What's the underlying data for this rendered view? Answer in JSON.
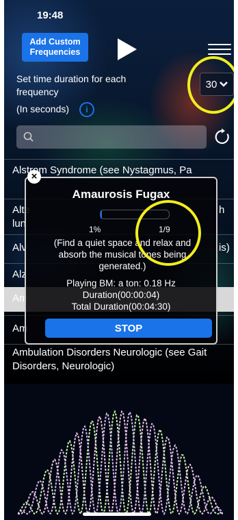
{
  "status": {
    "time": "19:48"
  },
  "header": {
    "add_button_label": "Add Custom Frequencies"
  },
  "duration": {
    "label": "Set time duration for each frequency",
    "units_label": "(In seconds)",
    "selected_value": "30"
  },
  "search": {
    "value": ""
  },
  "list": {
    "items": [
      {
        "label": "Alstrom Syndrome (see Nystagmus, Pa"
      },
      {
        "label": "Alte"
      },
      {
        "label": "lun"
      },
      {
        "label": "Alv"
      },
      {
        "label": "Alz"
      },
      {
        "label": "Am"
      },
      {
        "label": "Am"
      },
      {
        "label": "Ambulation Disorders Neurologic (see Gait Disorders, Neurologic)"
      }
    ],
    "peek_right": [
      "h",
      "is)"
    ]
  },
  "modal": {
    "title": "Amaurosis Fugax",
    "progress_percent_label": "1%",
    "progress_fraction_label": "1/9",
    "progress_value": 0.01,
    "instructions": "(Find a quiet space and relax and absorb the musical tones being generated.)",
    "playing_line": "Playing BM: a ton: 0.18 Hz",
    "duration_line": "Duration(00:00:04)",
    "total_duration_line": "Total Duration(00:04:30)",
    "stop_label": "STOP"
  },
  "colors": {
    "accent": "#1a73e8",
    "highlight_ring": "#f0ee1e"
  }
}
